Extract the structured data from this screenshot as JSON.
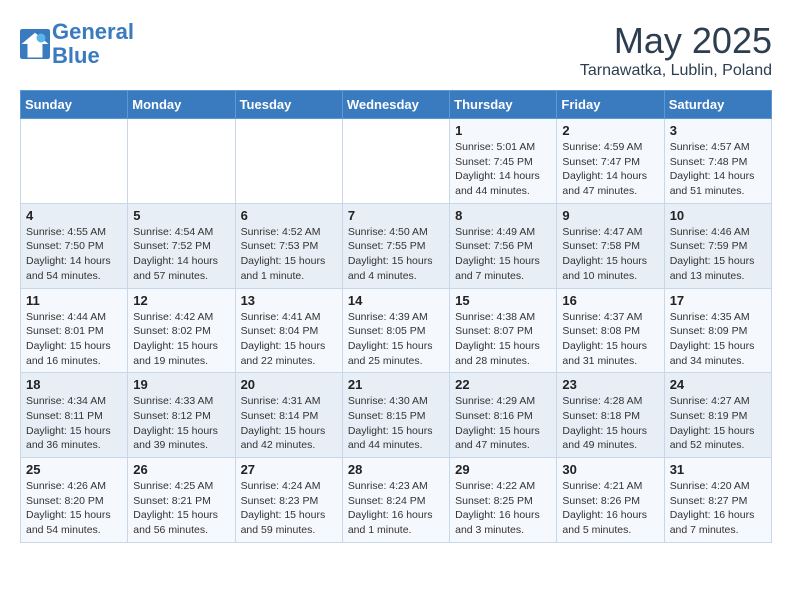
{
  "header": {
    "logo_line1": "General",
    "logo_line2": "Blue",
    "month_title": "May 2025",
    "subtitle": "Tarnawatka, Lublin, Poland"
  },
  "days_of_week": [
    "Sunday",
    "Monday",
    "Tuesday",
    "Wednesday",
    "Thursday",
    "Friday",
    "Saturday"
  ],
  "weeks": [
    [
      {
        "day": "",
        "content": ""
      },
      {
        "day": "",
        "content": ""
      },
      {
        "day": "",
        "content": ""
      },
      {
        "day": "",
        "content": ""
      },
      {
        "day": "1",
        "content": "Sunrise: 5:01 AM\nSunset: 7:45 PM\nDaylight: 14 hours\nand 44 minutes."
      },
      {
        "day": "2",
        "content": "Sunrise: 4:59 AM\nSunset: 7:47 PM\nDaylight: 14 hours\nand 47 minutes."
      },
      {
        "day": "3",
        "content": "Sunrise: 4:57 AM\nSunset: 7:48 PM\nDaylight: 14 hours\nand 51 minutes."
      }
    ],
    [
      {
        "day": "4",
        "content": "Sunrise: 4:55 AM\nSunset: 7:50 PM\nDaylight: 14 hours\nand 54 minutes."
      },
      {
        "day": "5",
        "content": "Sunrise: 4:54 AM\nSunset: 7:52 PM\nDaylight: 14 hours\nand 57 minutes."
      },
      {
        "day": "6",
        "content": "Sunrise: 4:52 AM\nSunset: 7:53 PM\nDaylight: 15 hours\nand 1 minute."
      },
      {
        "day": "7",
        "content": "Sunrise: 4:50 AM\nSunset: 7:55 PM\nDaylight: 15 hours\nand 4 minutes."
      },
      {
        "day": "8",
        "content": "Sunrise: 4:49 AM\nSunset: 7:56 PM\nDaylight: 15 hours\nand 7 minutes."
      },
      {
        "day": "9",
        "content": "Sunrise: 4:47 AM\nSunset: 7:58 PM\nDaylight: 15 hours\nand 10 minutes."
      },
      {
        "day": "10",
        "content": "Sunrise: 4:46 AM\nSunset: 7:59 PM\nDaylight: 15 hours\nand 13 minutes."
      }
    ],
    [
      {
        "day": "11",
        "content": "Sunrise: 4:44 AM\nSunset: 8:01 PM\nDaylight: 15 hours\nand 16 minutes."
      },
      {
        "day": "12",
        "content": "Sunrise: 4:42 AM\nSunset: 8:02 PM\nDaylight: 15 hours\nand 19 minutes."
      },
      {
        "day": "13",
        "content": "Sunrise: 4:41 AM\nSunset: 8:04 PM\nDaylight: 15 hours\nand 22 minutes."
      },
      {
        "day": "14",
        "content": "Sunrise: 4:39 AM\nSunset: 8:05 PM\nDaylight: 15 hours\nand 25 minutes."
      },
      {
        "day": "15",
        "content": "Sunrise: 4:38 AM\nSunset: 8:07 PM\nDaylight: 15 hours\nand 28 minutes."
      },
      {
        "day": "16",
        "content": "Sunrise: 4:37 AM\nSunset: 8:08 PM\nDaylight: 15 hours\nand 31 minutes."
      },
      {
        "day": "17",
        "content": "Sunrise: 4:35 AM\nSunset: 8:09 PM\nDaylight: 15 hours\nand 34 minutes."
      }
    ],
    [
      {
        "day": "18",
        "content": "Sunrise: 4:34 AM\nSunset: 8:11 PM\nDaylight: 15 hours\nand 36 minutes."
      },
      {
        "day": "19",
        "content": "Sunrise: 4:33 AM\nSunset: 8:12 PM\nDaylight: 15 hours\nand 39 minutes."
      },
      {
        "day": "20",
        "content": "Sunrise: 4:31 AM\nSunset: 8:14 PM\nDaylight: 15 hours\nand 42 minutes."
      },
      {
        "day": "21",
        "content": "Sunrise: 4:30 AM\nSunset: 8:15 PM\nDaylight: 15 hours\nand 44 minutes."
      },
      {
        "day": "22",
        "content": "Sunrise: 4:29 AM\nSunset: 8:16 PM\nDaylight: 15 hours\nand 47 minutes."
      },
      {
        "day": "23",
        "content": "Sunrise: 4:28 AM\nSunset: 8:18 PM\nDaylight: 15 hours\nand 49 minutes."
      },
      {
        "day": "24",
        "content": "Sunrise: 4:27 AM\nSunset: 8:19 PM\nDaylight: 15 hours\nand 52 minutes."
      }
    ],
    [
      {
        "day": "25",
        "content": "Sunrise: 4:26 AM\nSunset: 8:20 PM\nDaylight: 15 hours\nand 54 minutes."
      },
      {
        "day": "26",
        "content": "Sunrise: 4:25 AM\nSunset: 8:21 PM\nDaylight: 15 hours\nand 56 minutes."
      },
      {
        "day": "27",
        "content": "Sunrise: 4:24 AM\nSunset: 8:23 PM\nDaylight: 15 hours\nand 59 minutes."
      },
      {
        "day": "28",
        "content": "Sunrise: 4:23 AM\nSunset: 8:24 PM\nDaylight: 16 hours\nand 1 minute."
      },
      {
        "day": "29",
        "content": "Sunrise: 4:22 AM\nSunset: 8:25 PM\nDaylight: 16 hours\nand 3 minutes."
      },
      {
        "day": "30",
        "content": "Sunrise: 4:21 AM\nSunset: 8:26 PM\nDaylight: 16 hours\nand 5 minutes."
      },
      {
        "day": "31",
        "content": "Sunrise: 4:20 AM\nSunset: 8:27 PM\nDaylight: 16 hours\nand 7 minutes."
      }
    ]
  ]
}
